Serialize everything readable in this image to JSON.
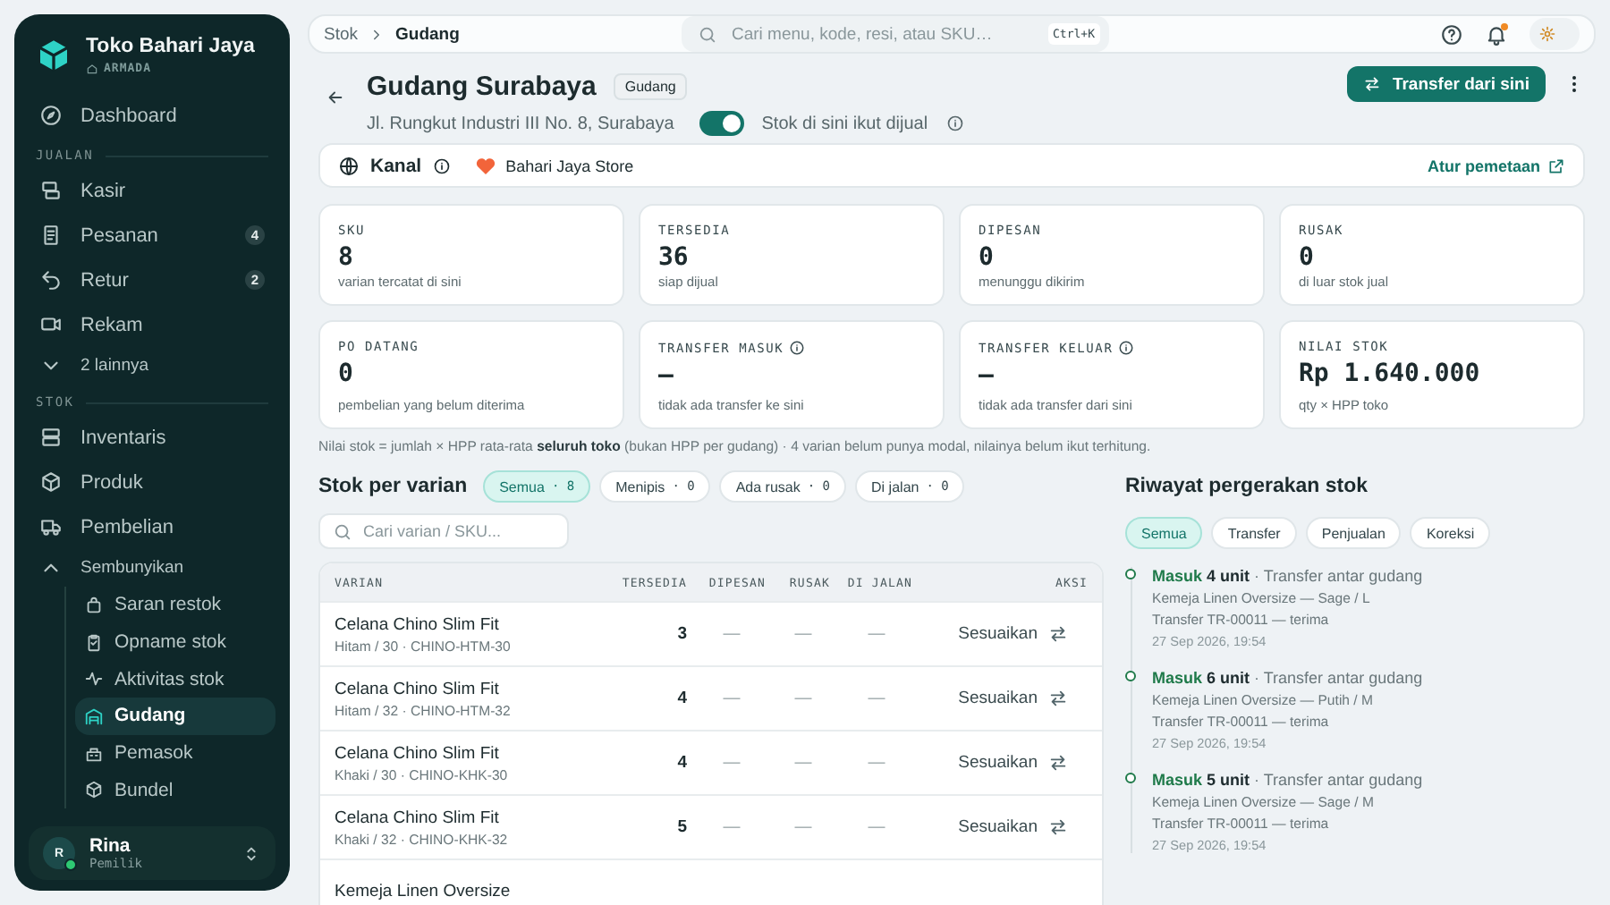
{
  "sidebar": {
    "brand": {
      "name": "Toko Bahari Jaya",
      "sub": "ARMADA"
    },
    "top_items": [
      {
        "label": "Dashboard",
        "selected": false
      }
    ],
    "sections": [
      {
        "title": "JUALAN",
        "items": [
          {
            "label": "Kasir",
            "selected": false
          },
          {
            "label": "Pesanan",
            "selected": false,
            "badge": "4"
          },
          {
            "label": "Retur",
            "selected": false,
            "badge": "2"
          },
          {
            "label": "Rekam",
            "selected": false
          },
          {
            "label": "2 lainnya",
            "kind": "toggle",
            "expanded": false
          }
        ]
      },
      {
        "title": "STOK",
        "items": [
          {
            "label": "Inventaris",
            "selected": false
          },
          {
            "label": "Produk",
            "selected": false
          },
          {
            "label": "Pembelian",
            "selected": false
          },
          {
            "label": "Sembunyikan",
            "kind": "toggle",
            "expanded": true,
            "children": [
              {
                "label": "Saran restok",
                "selected": false
              },
              {
                "label": "Opname stok",
                "selected": false
              },
              {
                "label": "Aktivitas stok",
                "selected": false
              },
              {
                "label": "Gudang",
                "selected": true
              },
              {
                "label": "Pemasok",
                "selected": false
              },
              {
                "label": "Bundel",
                "selected": false
              }
            ]
          }
        ]
      }
    ],
    "user": {
      "initial": "R",
      "name": "Rina",
      "role": "Pemilik",
      "online": true
    }
  },
  "top_bar": {
    "breadcrumb": [
      "Stok",
      "Gudang"
    ],
    "search": {
      "placeholder": "Cari menu, kode, resi, atau SKU…",
      "shortcut": "Ctrl+K"
    },
    "notifications_unread": true,
    "dark_mode": false
  },
  "header": {
    "title": "Gudang Surabaya",
    "tag": "Gudang",
    "address": "Jl. Rungkut Industri III No. 8, Surabaya",
    "sell_toggle": {
      "label": "Stok di sini ikut dijual",
      "on": true
    },
    "primary_button": "Transfer dari sini"
  },
  "channel": {
    "label": "Kanal",
    "store": "Bahari Jaya Store",
    "link": "Atur pemetaan"
  },
  "stats": [
    {
      "label": "SKU",
      "value": "8",
      "sub": "varian tercatat di sini",
      "info": false
    },
    {
      "label": "TERSEDIA",
      "value": "36",
      "sub": "siap dijual",
      "info": false
    },
    {
      "label": "DIPESAN",
      "value": "0",
      "sub": "menunggu dikirim",
      "info": false
    },
    {
      "label": "RUSAK",
      "value": "0",
      "sub": "di luar stok jual",
      "info": false
    },
    {
      "label": "PO DATANG",
      "value": "0",
      "sub": "pembelian yang belum diterima",
      "info": false
    },
    {
      "label": "TRANSFER MASUK",
      "value": "—",
      "sub": "tidak ada transfer ke sini",
      "info": true
    },
    {
      "label": "TRANSFER KELUAR",
      "value": "—",
      "sub": "tidak ada transfer dari sini",
      "info": true
    },
    {
      "label": "NILAI STOK",
      "value": "Rp 1.640.000",
      "sub": "qty × HPP toko",
      "info": false
    }
  ],
  "note": "Nilai stok = jumlah × HPP rata-rata **seluruh toko** (bukan HPP per gudang) · 4 varian belum punya modal, nilainya belum ikut terhitung.",
  "variants": {
    "title": "Stok per varian",
    "filters": [
      {
        "label": "Semua",
        "count": "· 8",
        "selected": true
      },
      {
        "label": "Menipis",
        "count": "· 0",
        "selected": false
      },
      {
        "label": "Ada rusak",
        "count": "· 0",
        "selected": false
      },
      {
        "label": "Di jalan",
        "count": "· 0",
        "selected": false
      }
    ],
    "search": {
      "placeholder": "Cari varian / SKU..."
    },
    "table": {
      "columns": [
        "VARIAN",
        "TERSEDIA",
        "DIPESAN",
        "RUSAK",
        "DI JALAN",
        "AKSI"
      ],
      "rows": [
        {
          "name": "Celana Chino Slim Fit",
          "detail": "Hitam / 30 · CHINO-HTM-30",
          "available": "3",
          "ordered": "—",
          "damaged": "—",
          "in_transit": "—",
          "action": "Sesuaikan"
        },
        {
          "name": "Celana Chino Slim Fit",
          "detail": "Hitam / 32 · CHINO-HTM-32",
          "available": "4",
          "ordered": "—",
          "damaged": "—",
          "in_transit": "—",
          "action": "Sesuaikan"
        },
        {
          "name": "Celana Chino Slim Fit",
          "detail": "Khaki / 30 · CHINO-KHK-30",
          "available": "4",
          "ordered": "—",
          "damaged": "—",
          "in_transit": "—",
          "action": "Sesuaikan"
        },
        {
          "name": "Celana Chino Slim Fit",
          "detail": "Khaki / 32 · CHINO-KHK-32",
          "available": "5",
          "ordered": "—",
          "damaged": "—",
          "in_transit": "—",
          "action": "Sesuaikan"
        },
        {
          "name": "Kemeja Linen Oversize"
        }
      ]
    }
  },
  "history": {
    "title": "Riwayat pergerakan stok",
    "filters": [
      {
        "label": "Semua",
        "selected": true
      },
      {
        "label": "Transfer",
        "selected": false
      },
      {
        "label": "Penjualan",
        "selected": false
      },
      {
        "label": "Koreksi",
        "selected": false
      }
    ],
    "entries": [
      {
        "direction": "Masuk",
        "qty": "4 unit",
        "type": "· Transfer antar gudang",
        "item": "Kemeja Linen Oversize — Sage / L",
        "ref": "Transfer TR-00011 — terima",
        "time": "27 Sep 2026, 19:54"
      },
      {
        "direction": "Masuk",
        "qty": "6 unit",
        "type": "· Transfer antar gudang",
        "item": "Kemeja Linen Oversize — Putih / M",
        "ref": "Transfer TR-00011 — terima",
        "time": "27 Sep 2026, 19:54"
      },
      {
        "direction": "Masuk",
        "qty": "5 unit",
        "type": "· Transfer antar gudang",
        "item": "Kemeja Linen Oversize — Sage / M",
        "ref": "Transfer TR-00011 — terima",
        "time": "27 Sep 2026, 19:54"
      }
    ]
  }
}
